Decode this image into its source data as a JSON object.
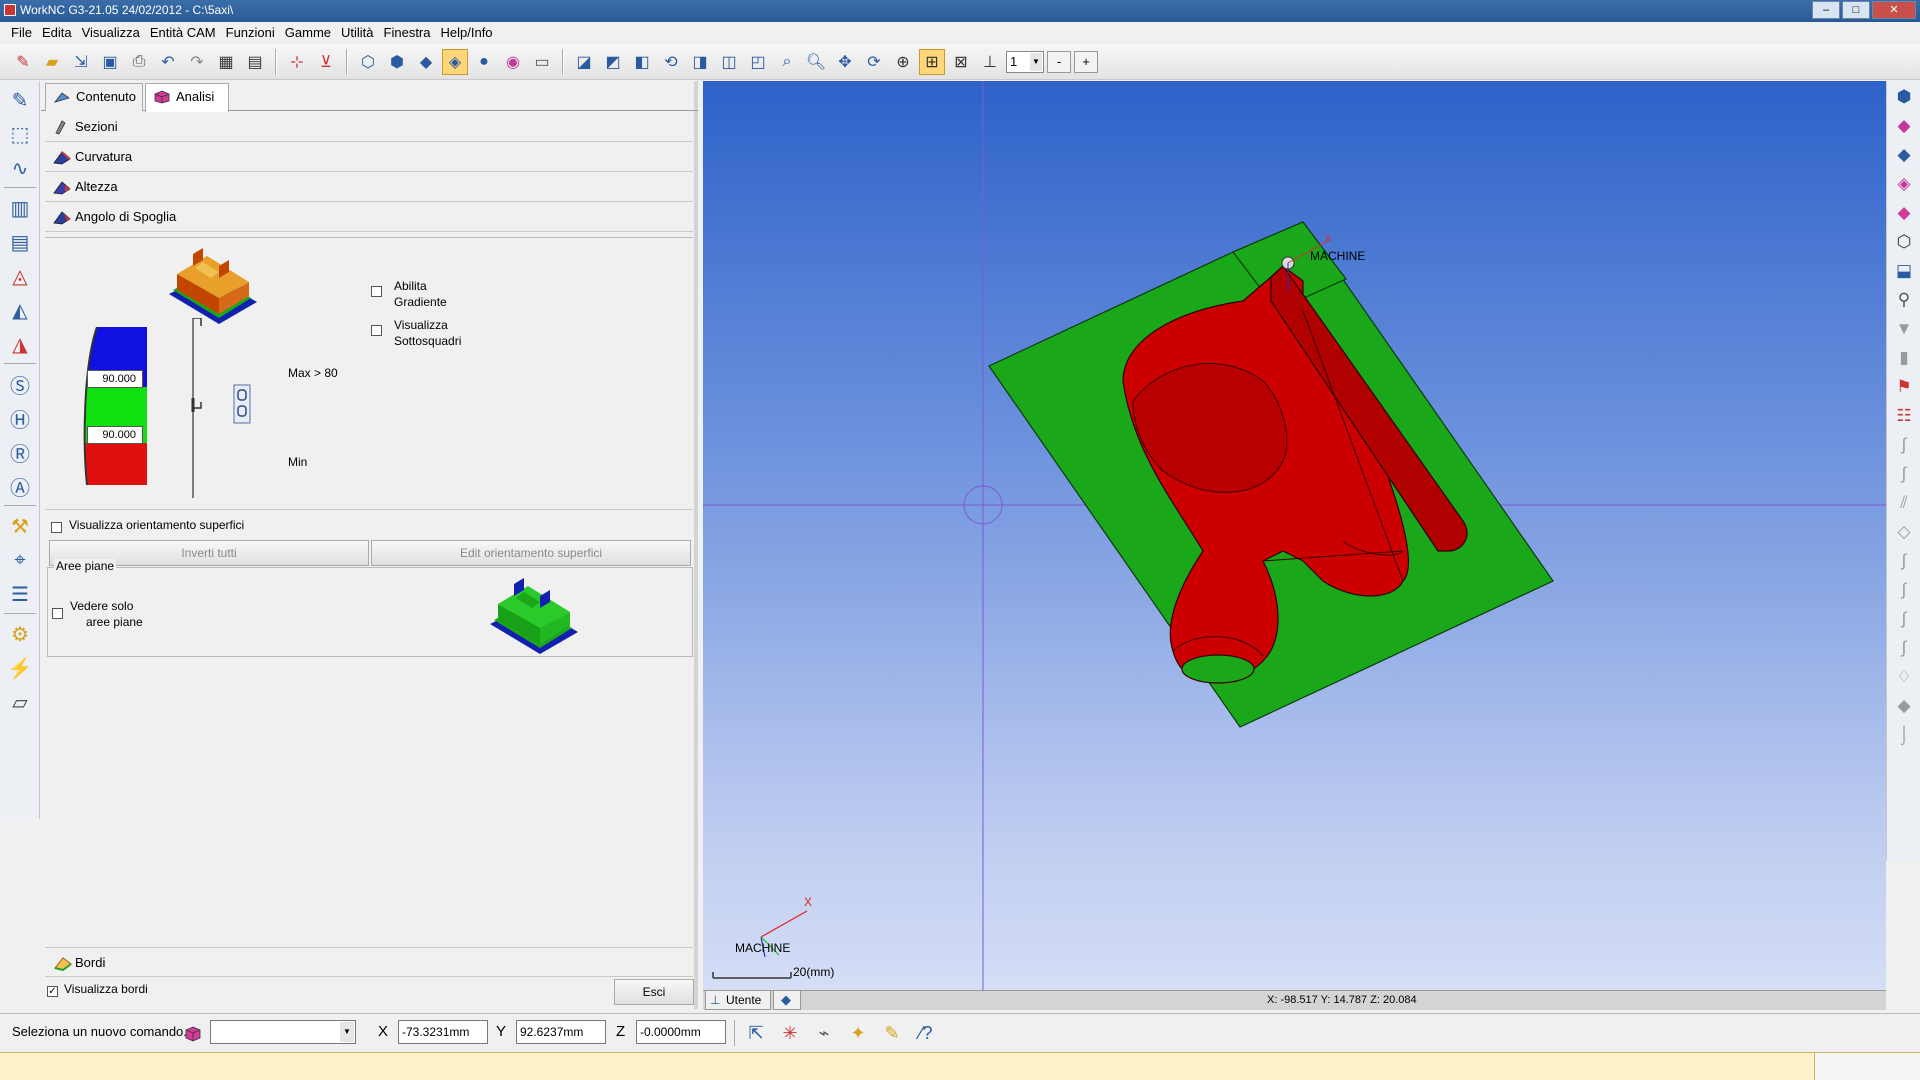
{
  "window": {
    "title": "WorkNC G3-21.05 24/02/2012 - C:\\5axi\\"
  },
  "menu": [
    "File",
    "Edita",
    "Visualizza",
    "Entità CAM",
    "Funzioni",
    "Gamme",
    "Utilità",
    "Finestra",
    "Help/Info"
  ],
  "toolbar": {
    "zoom_value": "1",
    "minus_label": "-",
    "plus_label": "+"
  },
  "panel": {
    "tabs": [
      "Contenuto",
      "Analisi"
    ],
    "sections": [
      "Sezioni",
      "Curvatura",
      "Altezza",
      "Angolo di Spoglia"
    ],
    "draft": {
      "abilita_label": "Abilita",
      "abilita_label2": "Gradiente",
      "sottosquadri_label": "Visualizza",
      "sottosquadri_label2": "Sottosquadri",
      "max_label": "Max > 80",
      "min_label": "Min",
      "value_top": "90.000",
      "value_bottom": "90.000",
      "colors": {
        "top": "#1010e0",
        "middle": "#10e010",
        "bottom": "#e01010"
      }
    },
    "orient_label": "Visualizza orientamento superfici",
    "invert_button": "Inverti tutti",
    "edit_orient_button": "Edit orientamento superfici",
    "aree": {
      "legend": "Aree piane",
      "check_label1": "Vedere solo",
      "check_label2": "aree piane"
    },
    "bordi_label": "Bordi",
    "visualizza_bordi": "Visualizza bordi",
    "esci_button": "Esci"
  },
  "viewport": {
    "machine_label": "MACHINE",
    "triad_label": "MACHINE",
    "triad_x": "X",
    "scale_label": "20(mm)",
    "colors": {
      "plate": "#1aa81a",
      "part": "#cc0000",
      "background_top": "#2d62c9"
    }
  },
  "viewtabs": {
    "utente": "Utente",
    "coords": "X: -98.517   Y: 14.787   Z: 20.084"
  },
  "cmdbar": {
    "prompt": "Seleziona un nuovo comando...",
    "x_label": "X",
    "x_value": "-73.3231mm",
    "y_label": "Y",
    "y_value": "92.6237mm",
    "z_label": "Z",
    "z_value": "-0.0000mm"
  }
}
